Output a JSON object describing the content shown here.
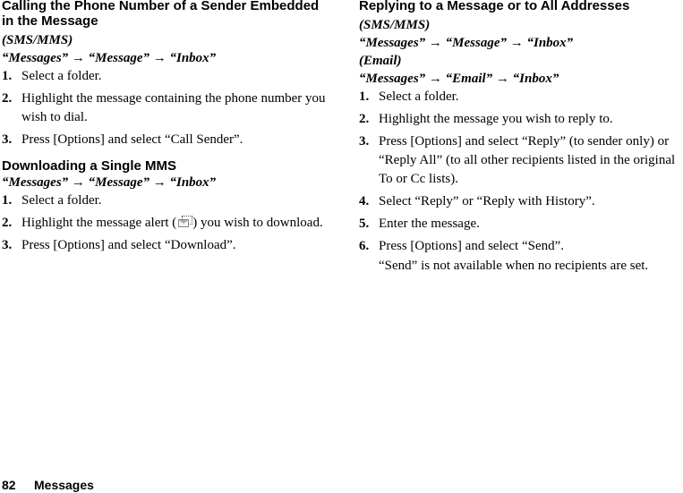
{
  "left": {
    "section1": {
      "title": "Calling the Phone Number of a Sender Embedded in the Message",
      "tag": "(SMS/MMS)",
      "path": "“Messages” → “Message” → “Inbox”",
      "steps": [
        {
          "num": "1.",
          "text": "Select a folder."
        },
        {
          "num": "2.",
          "text": "Highlight the message containing the phone number you wish to dial."
        },
        {
          "num": "3.",
          "text": "Press [Options] and select “Call Sender”."
        }
      ]
    },
    "section2": {
      "title": "Downloading a Single MMS",
      "path": "“Messages” → “Message” → “Inbox”",
      "steps": [
        {
          "num": "1.",
          "text": "Select a folder."
        },
        {
          "num": "2.",
          "text_before": "Highlight the message alert (",
          "icon": "mms-alert-icon",
          "text_after": ") you wish to download."
        },
        {
          "num": "3.",
          "text": "Press [Options] and select “Download”."
        }
      ]
    }
  },
  "right": {
    "section": {
      "title": "Replying to a Message or to All Addresses",
      "tag1": "(SMS/MMS)",
      "path1": "“Messages” → “Message” → “Inbox”",
      "tag2": "(Email)",
      "path2": "“Messages” → “Email” → “Inbox”",
      "steps": [
        {
          "num": "1.",
          "text": "Select a folder."
        },
        {
          "num": "2.",
          "text": "Highlight the message you wish to reply to."
        },
        {
          "num": "3.",
          "text": "Press [Options] and select “Reply” (to sender only) or “Reply All” (to all other recipients listed in the original To or Cc lists)."
        },
        {
          "num": "4.",
          "text": "Select “Reply” or “Reply with History”."
        },
        {
          "num": "5.",
          "text": "Enter the message."
        },
        {
          "num": "6.",
          "text": "Press [Options] and select “Send”."
        }
      ],
      "note": "“Send” is not available when no recipients are set."
    }
  },
  "footer": {
    "page_number": "82",
    "chapter": "Messages"
  }
}
